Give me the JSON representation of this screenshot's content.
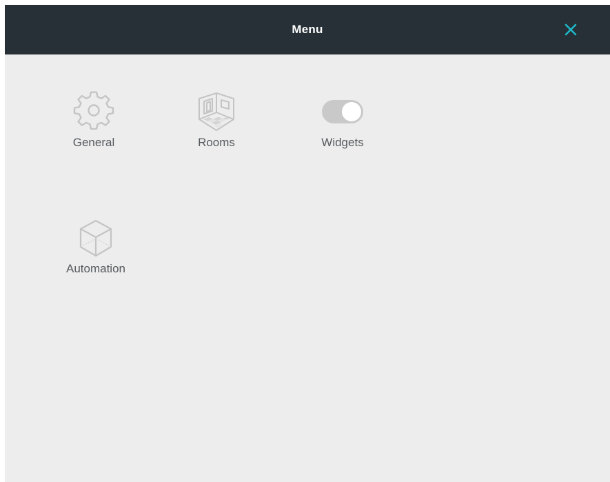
{
  "header": {
    "title": "Menu",
    "close_icon": "close-icon",
    "background": "#263036",
    "accent": "#1fb8c8"
  },
  "menu": {
    "items": [
      {
        "label": "General",
        "icon": "gear-icon"
      },
      {
        "label": "Rooms",
        "icon": "room-icon"
      },
      {
        "label": "Widgets",
        "icon": "toggle-icon"
      },
      {
        "label": "Automation",
        "icon": "cube-icon"
      }
    ],
    "icon_color": "#c4c4c4",
    "label_color": "#555a5e"
  }
}
